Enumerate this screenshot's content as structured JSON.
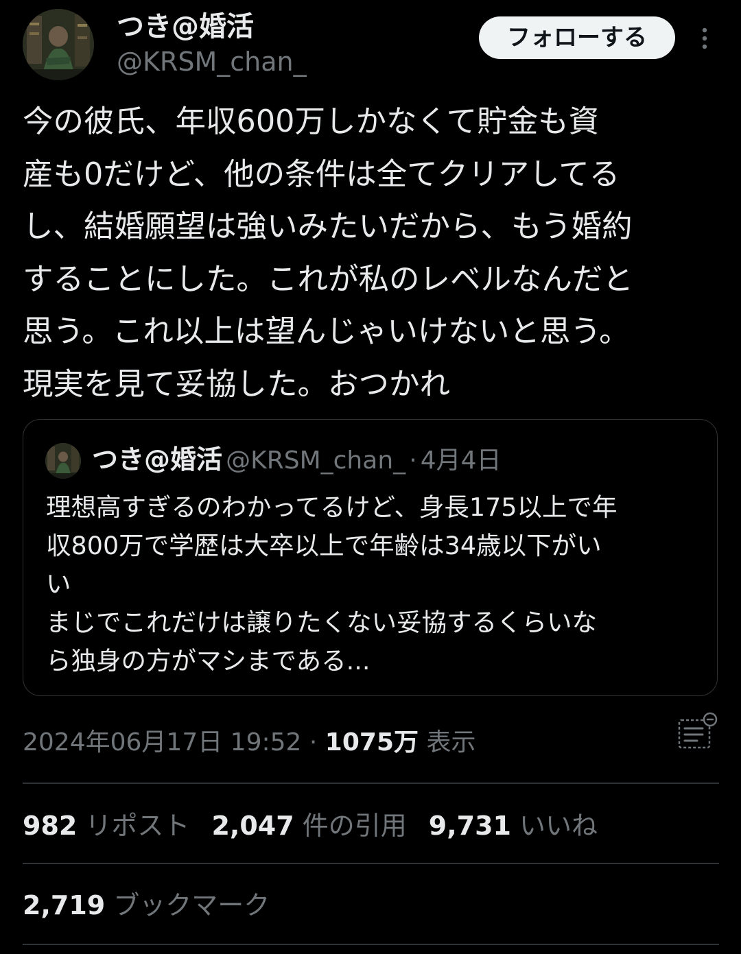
{
  "author": {
    "display_name": "つき@婚活",
    "handle": "@KRSM_chan_"
  },
  "follow_button": {
    "label": "フォローする"
  },
  "tweet": {
    "text": "今の彼氏、年収600万しかなくて貯金も資\n産も0だけど、他の条件は全てクリアしてる\nし、結婚願望は強いみたいだから、もう婚約\nすることにした。これが私のレベルなんだと\n思う。これ以上は望んじゃいけないと思う。\n現実を見て妥協した。おつかれ"
  },
  "quoted_tweet": {
    "display_name": "つき@婚活",
    "handle": "@KRSM_chan_",
    "separator": "·",
    "date": "4月4日",
    "text": "理想高すぎるのわかってるけど、身長175以上で年\n収800万で学歴は大卒以上で年齢は34歳以下がい\nい\nまじでこれだけは譲りたくない妥協するくらいな\nら独身の方がマシまである..."
  },
  "meta": {
    "timestamp": "2024年06月17日 19:52",
    "separator": "·",
    "views_count": "1075万",
    "views_label": "表示"
  },
  "stats": {
    "reposts": {
      "count": "982",
      "label": "リポスト"
    },
    "quotes": {
      "count": "2,047",
      "label": "件の引用"
    },
    "likes": {
      "count": "9,731",
      "label": "いいね"
    },
    "bookmarks": {
      "count": "2,719",
      "label": "ブックマーク"
    }
  },
  "icons": {
    "more": "more-vertical-icon",
    "analytics": "analytics-icon"
  },
  "colors": {
    "background": "#000000",
    "text_primary": "#e7e9ea",
    "text_secondary": "#71767b",
    "divider": "#2f3336",
    "follow_button_bg": "#eff3f4"
  }
}
